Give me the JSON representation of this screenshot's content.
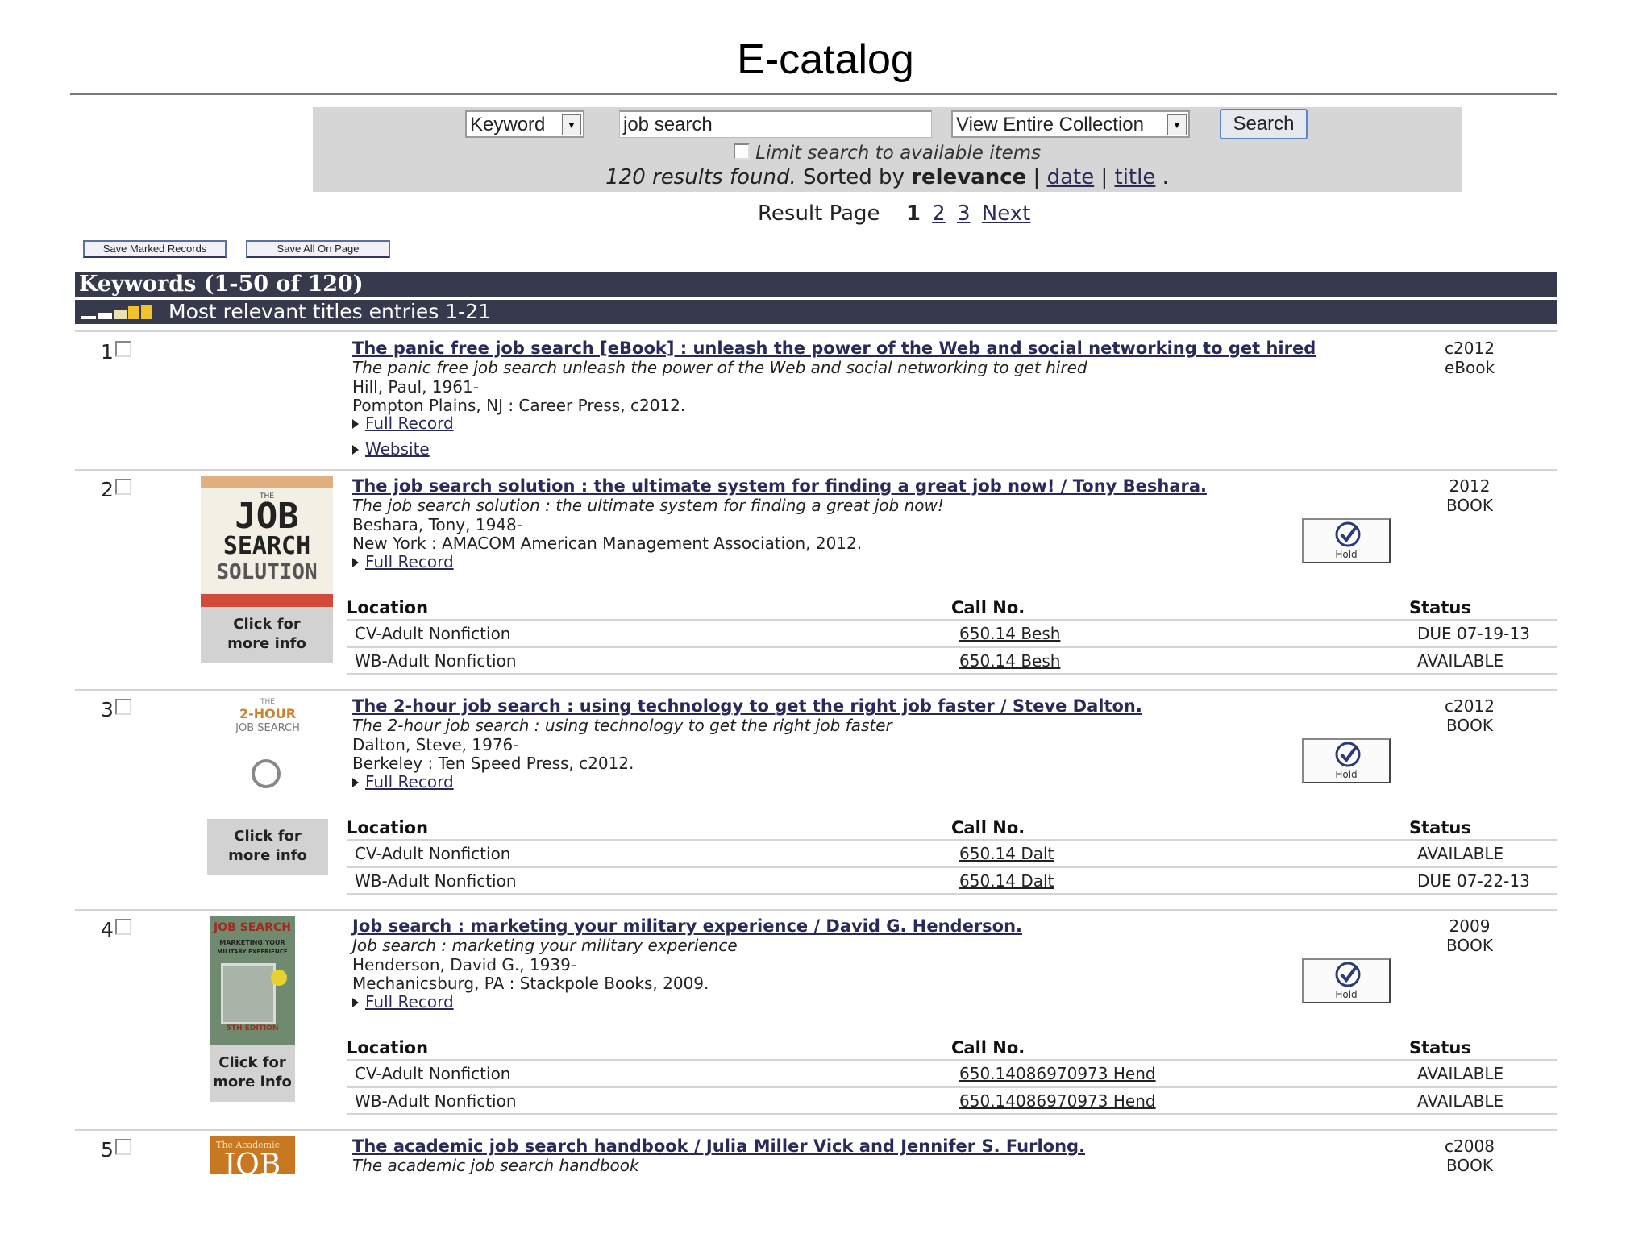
{
  "page": {
    "title": "E-catalog"
  },
  "search": {
    "type_value": "Keyword",
    "query_value": "job search",
    "collection_value": "View Entire Collection",
    "button_label": "Search",
    "limit_label": "Limit search to available items",
    "results_text": "120 results found.",
    "sorted_by_label": "Sorted by",
    "sort_relevance": "relevance",
    "sort_date": "date",
    "sort_title": "title",
    "separator": "|"
  },
  "pager": {
    "label": "Result Page",
    "current": "1",
    "page2": "2",
    "page3": "3",
    "next": "Next"
  },
  "toolbar": {
    "save_marked": "Save Marked Records",
    "save_all": "Save All On Page"
  },
  "results_heading": "Keywords (1-50 of 120)",
  "relevance_heading": "Most relevant titles entries 1-21",
  "records": [
    {
      "num": "1",
      "title": "The panic free job search [eBook] : unleash the power of the Web and social networking to get hired",
      "subtitle": "The panic free job search unleash the power of the Web and social networking to get hired",
      "author": "Hill, Paul, 1961-",
      "publisher": "Pompton Plains, NJ : Career Press, c2012.",
      "full_record": "Full Record",
      "website": "Website",
      "date": "c2012",
      "format": "eBook"
    },
    {
      "num": "2",
      "title": "The job search solution : the ultimate system for finding a great job now! / Tony Beshara.",
      "subtitle": "The job search solution : the ultimate system for finding a great job now!",
      "author": "Beshara, Tony, 1948-",
      "publisher": "New York : AMACOM American Management Association, 2012.",
      "full_record": "Full Record",
      "date": "2012",
      "format": "BOOK",
      "hold": "Hold",
      "cover_button": [
        "Click for",
        "more info"
      ],
      "cover_text": {
        "small": "THE",
        "big1": "JOB",
        "big2": "SEARCH",
        "big3": "SOLUTION"
      },
      "holdings": [
        {
          "location": "CV-Adult Nonfiction",
          "call_no": "650.14 Besh",
          "status": "DUE 07-19-13"
        },
        {
          "location": "WB-Adult Nonfiction",
          "call_no": "650.14 Besh",
          "status": "AVAILABLE"
        }
      ]
    },
    {
      "num": "3",
      "title": "The 2-hour job search : using technology to get the right job faster / Steve Dalton.",
      "subtitle": "The 2-hour job search : using technology to get the right job faster",
      "author": "Dalton, Steve, 1976-",
      "publisher": "Berkeley : Ten Speed Press, c2012.",
      "full_record": "Full Record",
      "date": "c2012",
      "format": "BOOK",
      "hold": "Hold",
      "cover_button": [
        "Click for",
        "more info"
      ],
      "cover_text": {
        "small": "THE",
        "big1": "2-HOUR",
        "big2": "JOB SEARCH"
      },
      "holdings": [
        {
          "location": "CV-Adult Nonfiction",
          "call_no": "650.14 Dalt",
          "status": "AVAILABLE"
        },
        {
          "location": "WB-Adult Nonfiction",
          "call_no": "650.14 Dalt",
          "status": "DUE 07-22-13"
        }
      ]
    },
    {
      "num": "4",
      "title": "Job search : marketing your military experience / David G. Henderson.",
      "subtitle": "Job search : marketing your military experience",
      "author": "Henderson, David G., 1939-",
      "publisher": "Mechanicsburg, PA : Stackpole Books, 2009.",
      "full_record": "Full Record",
      "date": "2009",
      "format": "BOOK",
      "hold": "Hold",
      "cover_button": [
        "Click for",
        "more info"
      ],
      "cover_text": {
        "big1": "JOB SEARCH",
        "big2": "MARKETING YOUR",
        "big3": "MILITARY EXPERIENCE",
        "edition": "5TH EDITION"
      },
      "holdings": [
        {
          "location": "CV-Adult Nonfiction",
          "call_no": "650.14086970973 Hend",
          "status": "AVAILABLE"
        },
        {
          "location": "WB-Adult Nonfiction",
          "call_no": "650.14086970973 Hend",
          "status": "AVAILABLE"
        }
      ]
    },
    {
      "num": "5",
      "title": "The academic job search handbook / Julia Miller Vick and Jennifer S. Furlong.",
      "subtitle": "The academic job search handbook",
      "date": "c2008",
      "format": "BOOK",
      "cover_text": {
        "small": "The Academic",
        "big1": "JOB"
      }
    }
  ],
  "holdings_headers": {
    "location": "Location",
    "call_no": "Call No.",
    "status": "Status"
  },
  "colors": {
    "header_bar": "#363a4c",
    "search_panel": "#d6d6d6",
    "link": "#2a2a5a",
    "button_border": "#5a86c8"
  }
}
